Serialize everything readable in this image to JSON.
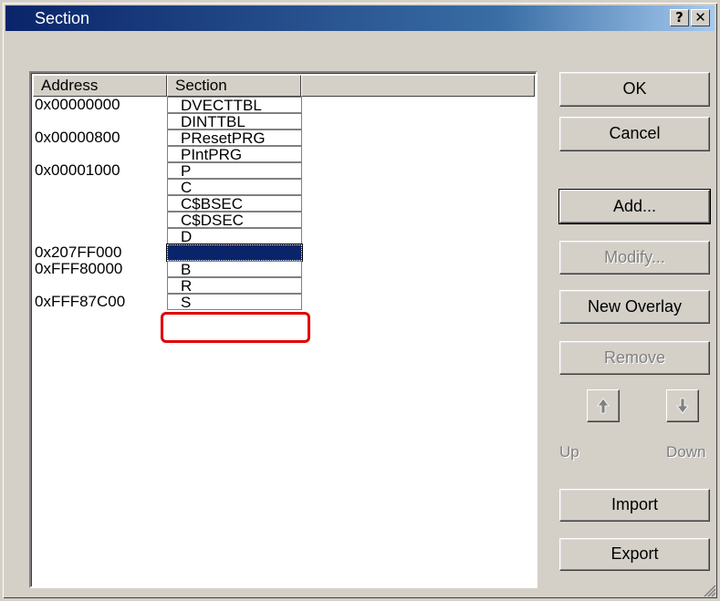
{
  "window": {
    "title": "Section",
    "help_label": "?",
    "close_label": "✕"
  },
  "table": {
    "columns": [
      "Address",
      "Section"
    ],
    "rows": [
      {
        "address": "0x00000000",
        "section": "DVECTTBL"
      },
      {
        "address": "",
        "section": "DINTTBL"
      },
      {
        "address": "0x00000800",
        "section": "PResetPRG"
      },
      {
        "address": "",
        "section": "PIntPRG"
      },
      {
        "address": "0x00001000",
        "section": "P"
      },
      {
        "address": "",
        "section": "C"
      },
      {
        "address": "",
        "section": "C$BSEC"
      },
      {
        "address": "",
        "section": "C$DSEC"
      },
      {
        "address": "",
        "section": "D"
      },
      {
        "address": "0x207FF000",
        "section": "",
        "selected": true
      },
      {
        "address": "0xFFF80000",
        "section": "B"
      },
      {
        "address": "",
        "section": "R"
      },
      {
        "address": "0xFFF87C00",
        "section": "S"
      }
    ]
  },
  "buttons": {
    "ok": "OK",
    "cancel": "Cancel",
    "add": "Add...",
    "modify": "Modify...",
    "new_overlay": "New Overlay",
    "remove": "Remove",
    "up": "Up",
    "down": "Down",
    "import": "Import",
    "export": "Export"
  },
  "colors": {
    "selection": "#0a246a",
    "highlight_box": "#e00000",
    "titlebar": "#0a246a"
  }
}
